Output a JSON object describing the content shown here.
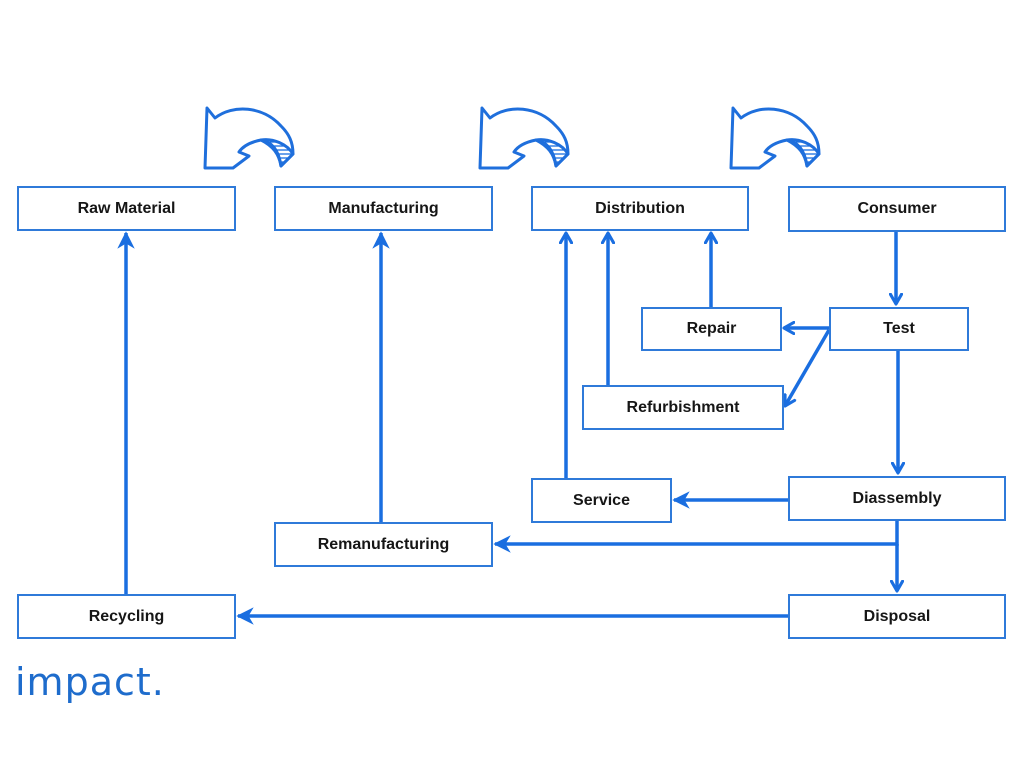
{
  "diagram": {
    "accent_color": "#1a6ee0",
    "box_border_color": "#2f7ad9",
    "nodes": {
      "raw_material": "Raw Material",
      "manufacturing": "Manufacturing",
      "distribution": "Distribution",
      "consumer": "Consumer",
      "repair": "Repair",
      "test": "Test",
      "refurbishment": "Refurbishment",
      "service": "Service",
      "disassembly": "Diassembly",
      "remanufacturing": "Remanufacturing",
      "recycling": "Recycling",
      "disposal": "Disposal"
    },
    "edges": [
      {
        "from": "consumer",
        "to": "test"
      },
      {
        "from": "test",
        "to": "repair"
      },
      {
        "from": "test",
        "to": "refurbishment"
      },
      {
        "from": "test",
        "to": "disassembly"
      },
      {
        "from": "repair",
        "to": "distribution"
      },
      {
        "from": "refurbishment",
        "to": "distribution"
      },
      {
        "from": "service",
        "to": "distribution"
      },
      {
        "from": "disassembly",
        "to": "service"
      },
      {
        "from": "disassembly",
        "to": "remanufacturing"
      },
      {
        "from": "disassembly",
        "to": "disposal"
      },
      {
        "from": "remanufacturing",
        "to": "manufacturing"
      },
      {
        "from": "disposal",
        "to": "recycling"
      },
      {
        "from": "recycling",
        "to": "raw_material"
      }
    ],
    "decorations": [
      "curved-arrow-icon",
      "curved-arrow-icon",
      "curved-arrow-icon"
    ]
  },
  "branding": {
    "logo_text": "impact."
  }
}
